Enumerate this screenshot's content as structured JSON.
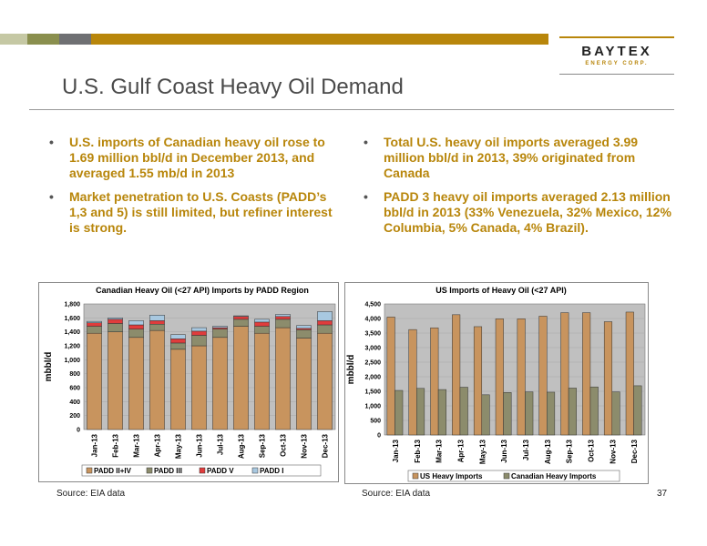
{
  "header": {
    "logo_name": "BAYTEX",
    "logo_sub": "ENERGY CORP.",
    "title": "U.S. Gulf Coast Heavy Oil Demand"
  },
  "bullets_left": [
    "U.S. imports of Canadian heavy oil rose to 1.69 million bbl/d in December 2013, and averaged 1.55 mb/d in 2013",
    "Market penetration to U.S. Coasts (PADD’s 1,3 and 5) is still limited, but refiner interest is strong."
  ],
  "bullets_right": [
    "Total U.S. heavy oil imports averaged 3.99 million bbl/d in 2013, 39% originated from Canada",
    "PADD 3 heavy oil imports averaged 2.13 million bbl/d in 2013 (33% Venezuela, 32% Mexico, 12% Columbia, 5% Canada, 4% Brazil)."
  ],
  "bullet_glyph": "•",
  "footer": {
    "source_left": "Source: EIA data",
    "source_right": "Source: EIA data",
    "page_number": "37"
  },
  "colors": {
    "accent": "#b8860b",
    "plot_bg": "#c0c0c0",
    "padd_2_4": "#c8945e",
    "padd_3": "#8c8c6c",
    "padd_5": "#e03c3c",
    "padd_1": "#a8c8e0",
    "us_heavy": "#c8945e",
    "canadian_heavy": "#8c8c6c"
  },
  "chart_data": [
    {
      "type": "bar",
      "stacked": true,
      "title": "Canadian Heavy Oil (<27 API) Imports by PADD Region",
      "ylabel": "mbbl/d",
      "ylim": [
        0,
        1800
      ],
      "yticks": [
        "0",
        "200",
        "400",
        "600",
        "800",
        "1,000",
        "1,200",
        "1,400",
        "1,600",
        "1,800"
      ],
      "categories": [
        "Jan-13",
        "Feb-13",
        "Mar-13",
        "Apr-13",
        "May-13",
        "Jun-13",
        "Jul-13",
        "Aug-13",
        "Sep-13",
        "Oct-13",
        "Nov-13",
        "Dec-13"
      ],
      "legend_position": "bottom",
      "series": [
        {
          "name": "PADD II+IV",
          "values": [
            1380,
            1400,
            1320,
            1420,
            1150,
            1200,
            1320,
            1480,
            1380,
            1460,
            1310,
            1380
          ]
        },
        {
          "name": "PADD III",
          "values": [
            100,
            120,
            120,
            90,
            90,
            150,
            120,
            100,
            100,
            120,
            120,
            120
          ]
        },
        {
          "name": "PADD V",
          "values": [
            50,
            60,
            60,
            50,
            60,
            60,
            20,
            40,
            60,
            40,
            20,
            60
          ]
        },
        {
          "name": "PADD I",
          "values": [
            20,
            20,
            60,
            80,
            60,
            50,
            20,
            10,
            40,
            30,
            40,
            130
          ]
        }
      ]
    },
    {
      "type": "bar",
      "title": "US Imports of Heavy Oil (<27 API)",
      "ylabel": "mbbl/d",
      "ylim": [
        0,
        4500
      ],
      "yticks": [
        "0",
        "500",
        "1,000",
        "1,500",
        "2,000",
        "2,500",
        "3,000",
        "3,500",
        "4,000",
        "4,500"
      ],
      "categories": [
        "Jan-13",
        "Feb-13",
        "Mar-13",
        "Apr-13",
        "May-13",
        "Jun-13",
        "Jul-13",
        "Aug-13",
        "Sep-13",
        "Oct-13",
        "Nov-13",
        "Dec-13"
      ],
      "legend_position": "bottom",
      "series": [
        {
          "name": "US Heavy Imports",
          "values": [
            4050,
            3620,
            3680,
            4130,
            3720,
            3990,
            3990,
            4080,
            4200,
            4200,
            3890,
            4220
          ]
        },
        {
          "name": "Canadian Heavy Imports",
          "values": [
            1530,
            1600,
            1560,
            1640,
            1380,
            1460,
            1480,
            1470,
            1610,
            1650,
            1480,
            1690
          ]
        }
      ]
    }
  ]
}
